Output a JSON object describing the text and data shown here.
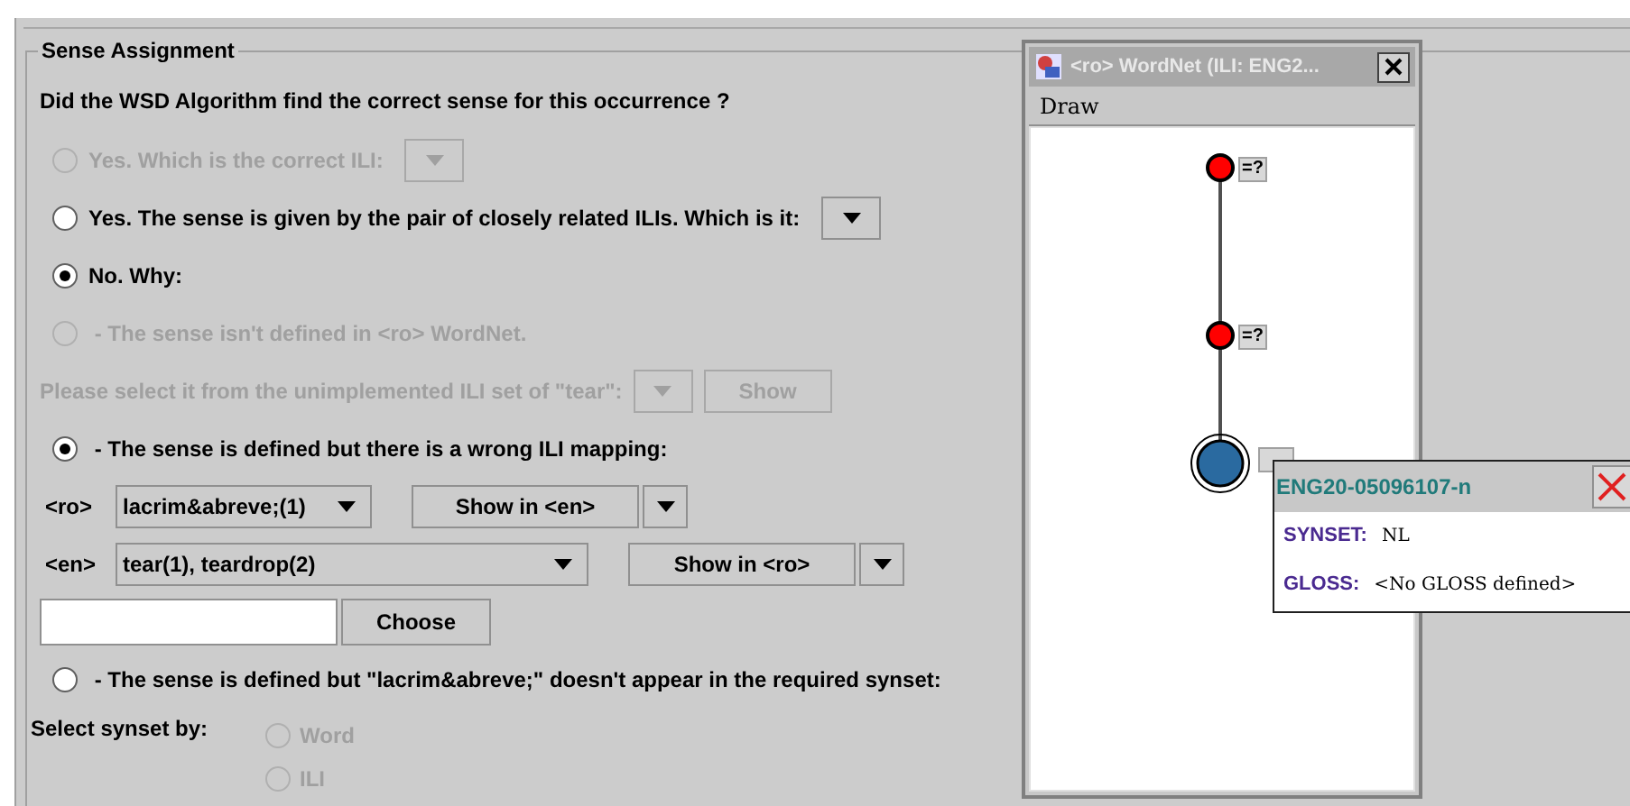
{
  "panel": {
    "title": "Sense Assignment",
    "question": "Did the WSD Algorithm find the correct sense for this occurrence ?"
  },
  "rows": [
    {
      "kind": "radio_combo",
      "label": "Yes. Which is the correct ILI:",
      "selected": false,
      "disabled": true
    },
    {
      "kind": "radio_combo",
      "label": "Yes. The sense is given by the pair of closely related ILIs. Which is it:",
      "selected": false,
      "disabled": false
    },
    {
      "kind": "radio",
      "label": "No. Why:",
      "selected": true,
      "disabled": false
    },
    {
      "kind": "radio",
      "label": " - The sense isn't defined in <ro> WordNet.",
      "selected": false,
      "disabled": true
    },
    {
      "kind": "combo_button",
      "label": "Please select it from the unimplemented ILI set of \"tear\":",
      "button": "Show",
      "disabled": true
    },
    {
      "kind": "radio",
      "label": " - The sense is defined but there is a wrong ILI mapping:",
      "selected": true,
      "disabled": false
    },
    {
      "kind": "mapping",
      "tag": "<ro>",
      "value": "lacrim&abreve;(1)",
      "button": "Show in <en>"
    },
    {
      "kind": "mapping",
      "tag": "<en>",
      "value": "tear(1), teardrop(2)",
      "button": "Show in <ro>"
    },
    {
      "kind": "input_button",
      "button": "Choose"
    },
    {
      "kind": "radio",
      "label": " - The sense is defined but \"lacrim&abreve;\" doesn't appear in the required synset:",
      "selected": false,
      "disabled": false
    }
  ],
  "synset_select": {
    "label": "Select synset by:",
    "options": [
      {
        "label": "Word",
        "selected": false,
        "disabled": true
      },
      {
        "label": "ILI",
        "selected": false,
        "disabled": true
      }
    ]
  },
  "window": {
    "title": "<ro> WordNet (ILI: ENG2...",
    "menu": [
      "Draw"
    ],
    "nodes": [
      {
        "label": "=?",
        "color": "#ff0000",
        "selected": false
      },
      {
        "label": "=?",
        "color": "#ff0000",
        "selected": false
      },
      {
        "color": "#2a6aa0",
        "selected": true
      }
    ],
    "popup": {
      "title": "ENG20-05096107-n",
      "fields": [
        {
          "key": "SYNSET:",
          "value": "NL"
        },
        {
          "key": "GLOSS:",
          "value": "<No GLOSS defined>"
        }
      ]
    }
  }
}
